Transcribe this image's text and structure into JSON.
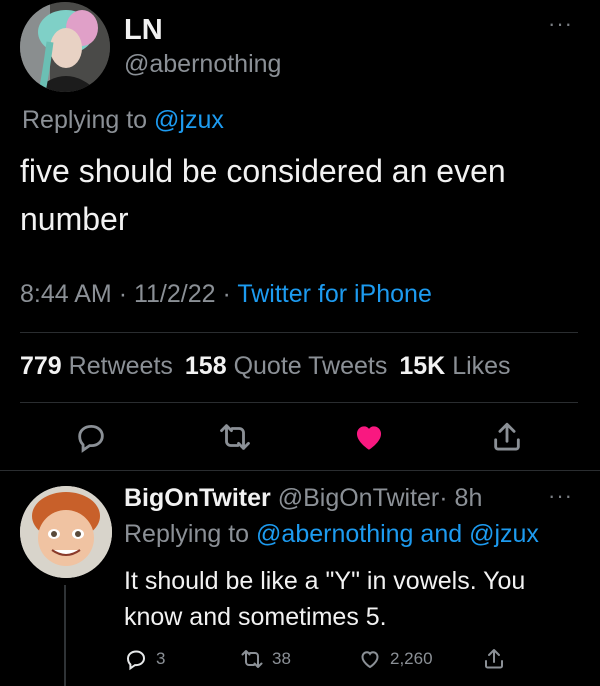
{
  "tweet": {
    "author_name": "LN",
    "author_handle": "@abernothing",
    "replying_prefix": "Replying to",
    "replying_to": "@jzux",
    "text": "five should be considered an even number",
    "time": "8:44 AM",
    "date": "11/2/22",
    "source": "Twitter for iPhone",
    "separator": "·",
    "more_icon": "ellipsis-icon"
  },
  "stats": {
    "retweets_count": "779",
    "retweets_label": "Retweets",
    "quotes_count": "158",
    "quotes_label": "Quote Tweets",
    "likes_count": "15K",
    "likes_label": "Likes"
  },
  "actions": {
    "reply_icon": "reply-icon",
    "retweet_icon": "retweet-icon",
    "like_icon": "heart-icon",
    "share_icon": "share-icon",
    "like_color": "#f91880",
    "icon_color": "#8b9096"
  },
  "reply": {
    "author_name": "BigOnTwiter",
    "author_handle": "@BigOnTwiter",
    "separator": "·",
    "age": "8h",
    "replying_prefix": "Replying to",
    "replying_to_1": "@abernothing",
    "replying_and": "and",
    "replying_to_2": "@jzux",
    "text": "It should be like a \"Y\" in vowels. You know and sometimes 5.",
    "reply_count": "3",
    "retweet_count": "38",
    "like_count": "2,260"
  },
  "colors": {
    "background": "#000000",
    "accent": "#1d9bf0",
    "secondary_text": "#8b9096"
  }
}
